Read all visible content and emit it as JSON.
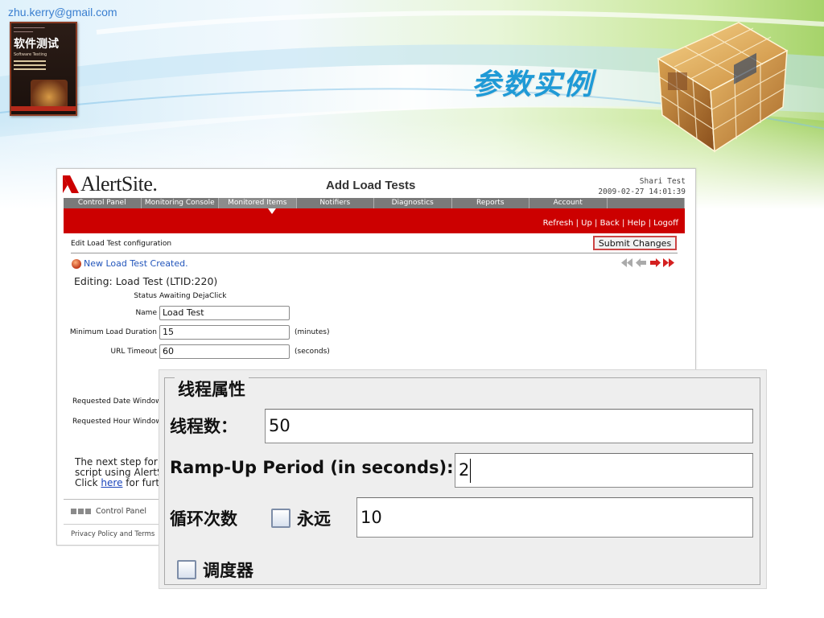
{
  "slide": {
    "email": "zhu.kerry@gmail.com",
    "title": "参数实例",
    "book": {
      "title": "软件测试",
      "subtitle": "Software Testing"
    }
  },
  "alertsite": {
    "logo_text": "AlertSite.",
    "page_title": "Add Load Tests",
    "user_name": "Shari Test",
    "timestamp": "2009-02-27 14:01:39",
    "nav": [
      "Control Panel",
      "Monitoring Console",
      "Monitored Items",
      "Notifiers",
      "Diagnostics",
      "Reports",
      "Account"
    ],
    "active_nav": "Monitored Items",
    "links": {
      "refresh": "Refresh",
      "up": "Up",
      "back": "Back",
      "help": "Help",
      "logoff": "Logoff",
      "separator": " | "
    },
    "section_label": "Edit Load Test configuration",
    "submit_label": "Submit Changes",
    "created_message": "New Load Test Created.",
    "editing": "Editing: Load Test (LTID:220)",
    "status_label": "Status",
    "status_value": "Awaiting DejaClick",
    "fields": {
      "name_label": "Name",
      "name_value": "Load Test",
      "min_duration_label": "Minimum Load Duration",
      "min_duration_value": "15",
      "min_duration_unit": "(minutes)",
      "url_timeout_label": "URL Timeout",
      "url_timeout_value": "60",
      "url_timeout_unit": "(seconds)"
    },
    "requested_date_label": "Requested Date Window",
    "requested_hour_label": "Requested Hour Window",
    "next_step_line1": "The next step for y",
    "next_step_line2": "script using AlertSi",
    "next_step_click": "Click ",
    "next_step_link": "here",
    "next_step_after": " for furth",
    "footer_control_panel": "Control Panel",
    "footer_privacy": "Privacy Policy and Terms"
  },
  "thread_group": {
    "legend": "线程属性",
    "threads_label": "线程数：",
    "threads_value": "50",
    "rampup_label": "Ramp-Up Period (in seconds):",
    "rampup_value": "2",
    "loop_label": "循环次数",
    "forever_label": "永远",
    "forever_checked": false,
    "loop_value": "10",
    "scheduler_label": "调度器",
    "scheduler_checked": false
  },
  "colors": {
    "alertsite_red": "#cc0000",
    "slide_title": "#1f9ad6",
    "email": "#3a7fd0"
  }
}
